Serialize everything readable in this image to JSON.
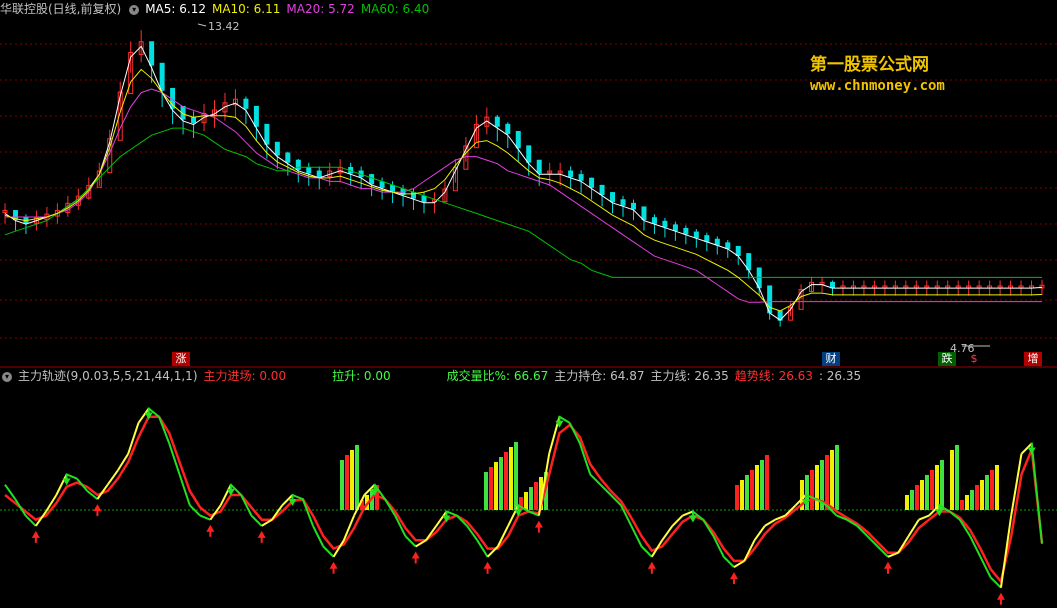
{
  "header": {
    "title": "华联控股(日线,前复权)",
    "ma5": "MA5: 6.12",
    "ma10": "MA10: 6.11",
    "ma20": "MA20: 5.72",
    "ma60": "MA60: 6.40"
  },
  "indicator_header": {
    "name": "主力轨迹(9,0.03,5,5,21,44,1,1)",
    "enter": "主力进场: 0.00",
    "pull": "拉升: 0.00",
    "vol_ratio": "成交量比%: 66.67",
    "hold": "主力持仓: 64.87",
    "line": "主力线: 26.35",
    "trend": "趋势线: 26.63",
    "extra": ": 26.35"
  },
  "watermark": {
    "title": "第一股票公式网",
    "url": "www.chnmoney.com"
  },
  "markers": [
    "涨",
    "财",
    "跌",
    "$",
    "增"
  ],
  "colors": {
    "ma5": "#ffffff",
    "ma10": "#f0f000",
    "ma20": "#e040e0",
    "ma60": "#00c000",
    "up": "#ff3030",
    "down": "#00e0e0",
    "main": "#ffff40",
    "trend": "#ff2020"
  },
  "chart_data": [
    {
      "type": "line",
      "panel": "price",
      "annotations": {
        "high": "13.42",
        "low": "4.76"
      },
      "x_count": 100,
      "series": [
        {
          "name": "MA5",
          "values": [
            8.2,
            8.0,
            7.9,
            8.0,
            8.1,
            8.2,
            8.4,
            8.6,
            8.9,
            9.3,
            10.2,
            11.5,
            12.6,
            12.9,
            12.3,
            11.6,
            11.1,
            10.8,
            10.7,
            10.9,
            11.0,
            11.2,
            11.3,
            11.1,
            10.6,
            10.1,
            9.8,
            9.6,
            9.4,
            9.3,
            9.2,
            9.3,
            9.4,
            9.3,
            9.2,
            9.0,
            8.9,
            8.8,
            8.7,
            8.6,
            8.5,
            8.5,
            8.8,
            9.4,
            10.0,
            10.6,
            10.8,
            10.6,
            10.4,
            10.0,
            9.6,
            9.3,
            9.3,
            9.3,
            9.2,
            9.1,
            8.9,
            8.7,
            8.5,
            8.4,
            8.3,
            8.0,
            7.9,
            7.8,
            7.7,
            7.6,
            7.5,
            7.4,
            7.3,
            7.2,
            7.0,
            6.6,
            6.1,
            5.4,
            5.2,
            5.5,
            6.0,
            6.2,
            6.2,
            6.1,
            6.1,
            6.1,
            6.1,
            6.1,
            6.1,
            6.1,
            6.1,
            6.1,
            6.1,
            6.1,
            6.1,
            6.1,
            6.1,
            6.1,
            6.1,
            6.1,
            6.1,
            6.1,
            6.1,
            6.12
          ]
        },
        {
          "name": "MA20",
          "values": [
            8.1,
            8.1,
            8.1,
            8.1,
            8.1,
            8.2,
            8.3,
            8.5,
            8.8,
            9.3,
            9.9,
            10.6,
            11.2,
            11.6,
            11.7,
            11.6,
            11.4,
            11.2,
            11.1,
            11.0,
            10.9,
            10.7,
            10.5,
            10.2,
            9.9,
            9.7,
            9.5,
            9.4,
            9.3,
            9.2,
            9.2,
            9.1,
            9.1,
            9.0,
            8.9,
            8.9,
            8.8,
            8.8,
            8.8,
            8.9,
            9.1,
            9.3,
            9.5,
            9.7,
            9.8,
            9.8,
            9.7,
            9.6,
            9.4,
            9.3,
            9.2,
            9.1,
            9.0,
            8.8,
            8.6,
            8.4,
            8.2,
            8.0,
            7.8,
            7.6,
            7.4,
            7.2,
            7.0,
            6.9,
            6.8,
            6.7,
            6.6,
            6.4,
            6.2,
            6.0,
            5.8,
            5.7,
            5.7,
            5.72,
            5.72,
            5.72,
            5.72,
            5.72,
            5.72,
            5.72,
            5.72,
            5.72,
            5.72,
            5.72,
            5.72,
            5.72,
            5.72,
            5.72,
            5.72,
            5.72,
            5.72,
            5.72,
            5.72,
            5.72,
            5.72,
            5.72,
            5.72,
            5.72,
            5.72,
            5.72
          ]
        },
        {
          "name": "MA60",
          "values": [
            7.6,
            7.7,
            7.8,
            7.9,
            8.0,
            8.2,
            8.4,
            8.6,
            8.9,
            9.2,
            9.5,
            9.8,
            10.0,
            10.2,
            10.4,
            10.5,
            10.6,
            10.6,
            10.5,
            10.4,
            10.2,
            10.0,
            9.9,
            9.8,
            9.6,
            9.5,
            9.4,
            9.4,
            9.5,
            9.5,
            9.5,
            9.5,
            9.5,
            9.4,
            9.3,
            9.2,
            9.1,
            9.0,
            8.9,
            8.8,
            8.7,
            8.6,
            8.5,
            8.4,
            8.3,
            8.2,
            8.1,
            8.0,
            7.9,
            7.8,
            7.7,
            7.5,
            7.3,
            7.1,
            6.9,
            6.8,
            6.6,
            6.5,
            6.4,
            6.4,
            6.4,
            6.4,
            6.4,
            6.4,
            6.4,
            6.4,
            6.4,
            6.4,
            6.4,
            6.4,
            6.4,
            6.4,
            6.4,
            6.4,
            6.4,
            6.4,
            6.4,
            6.4,
            6.4,
            6.4,
            6.4,
            6.4,
            6.4,
            6.4,
            6.4,
            6.4,
            6.4,
            6.4,
            6.4,
            6.4,
            6.4,
            6.4,
            6.4,
            6.4,
            6.4,
            6.4,
            6.4,
            6.4,
            6.4,
            6.4
          ]
        }
      ]
    },
    {
      "type": "line",
      "panel": "indicator",
      "series": [
        {
          "name": "主力线",
          "values": [
            55,
            48,
            40,
            35,
            42,
            50,
            60,
            58,
            52,
            48,
            55,
            62,
            70,
            85,
            92,
            88,
            75,
            60,
            45,
            40,
            38,
            45,
            55,
            50,
            40,
            35,
            38,
            45,
            50,
            48,
            35,
            25,
            20,
            28,
            40,
            50,
            55,
            48,
            40,
            30,
            25,
            28,
            35,
            42,
            40,
            35,
            28,
            20,
            25,
            35,
            45,
            42,
            40,
            70,
            88,
            85,
            75,
            60,
            55,
            50,
            45,
            35,
            25,
            20,
            28,
            35,
            40,
            42,
            38,
            30,
            20,
            15,
            18,
            28,
            35,
            38,
            40,
            45,
            50,
            48,
            45,
            40,
            38,
            35,
            30,
            25,
            20,
            22,
            30,
            38,
            40,
            45,
            42,
            38,
            30,
            20,
            10,
            5,
            40,
            70,
            75,
            26.35
          ]
        },
        {
          "name": "趋势线",
          "values": [
            50,
            46,
            42,
            38,
            40,
            46,
            54,
            56,
            54,
            50,
            52,
            58,
            66,
            78,
            88,
            88,
            80,
            66,
            52,
            44,
            40,
            42,
            50,
            50,
            44,
            38,
            38,
            42,
            47,
            48,
            40,
            30,
            24,
            26,
            34,
            44,
            50,
            48,
            42,
            34,
            28,
            28,
            32,
            38,
            40,
            37,
            31,
            24,
            24,
            30,
            40,
            42,
            41,
            60,
            80,
            84,
            78,
            65,
            58,
            52,
            47,
            39,
            30,
            23,
            25,
            31,
            37,
            40,
            38,
            32,
            24,
            18,
            18,
            24,
            31,
            36,
            39,
            43,
            47,
            48,
            46,
            42,
            39,
            36,
            32,
            27,
            22,
            22,
            27,
            34,
            38,
            42,
            42,
            39,
            33,
            24,
            14,
            8,
            30,
            60,
            72,
            26.63
          ]
        }
      ]
    }
  ]
}
